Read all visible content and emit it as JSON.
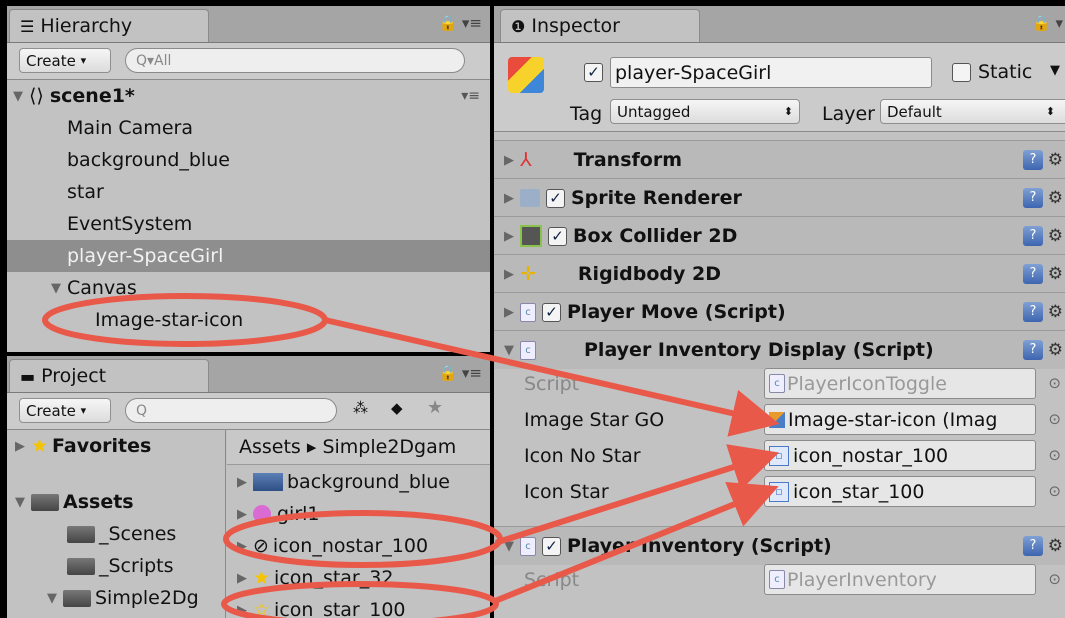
{
  "hierarchy": {
    "tab_label": "Hierarchy",
    "create_label": "Create",
    "search_placeholder": "Q▾All",
    "scene_name": "scene1*",
    "items": [
      {
        "label": "Main Camera"
      },
      {
        "label": "background_blue"
      },
      {
        "label": "star"
      },
      {
        "label": "EventSystem"
      },
      {
        "label": "player-SpaceGirl"
      },
      {
        "label": "Canvas"
      },
      {
        "label": "Image-star-icon"
      }
    ]
  },
  "project": {
    "tab_label": "Project",
    "create_label": "Create",
    "search_placeholder": "Q",
    "favorites_label": "Favorites",
    "assets_label": "Assets",
    "folders": [
      {
        "label": "_Scenes"
      },
      {
        "label": "_Scripts"
      },
      {
        "label": "Simple2Dg"
      }
    ],
    "breadcrumb": "Assets ▸ Simple2Dgam",
    "files": [
      {
        "label": "background_blue"
      },
      {
        "label": "girl1"
      },
      {
        "label": "icon_nostar_100"
      },
      {
        "label": "icon_star_32"
      },
      {
        "label": "icon_star_100"
      }
    ]
  },
  "inspector": {
    "tab_label": "Inspector",
    "object_name": "player-SpaceGirl",
    "static_label": "Static",
    "tag_label": "Tag",
    "tag_value": "Untagged",
    "layer_label": "Layer",
    "layer_value": "Default",
    "components": [
      {
        "label": "Transform"
      },
      {
        "label": "Sprite Renderer"
      },
      {
        "label": "Box Collider 2D"
      },
      {
        "label": "Rigidbody 2D"
      },
      {
        "label": "Player Move (Script)"
      },
      {
        "label": "Player Inventory Display (Script)"
      }
    ],
    "display_props": [
      {
        "label": "Script",
        "value": "PlayerIconToggle"
      },
      {
        "label": "Image Star GO",
        "value": "Image-star-icon (Imag"
      },
      {
        "label": "Icon No Star",
        "value": "icon_nostar_100"
      },
      {
        "label": "Icon Star",
        "value": "icon_star_100"
      }
    ],
    "inventory_component": "Player Inventory (Script)",
    "inventory_script_label": "Script",
    "inventory_script_value": "PlayerInventory"
  },
  "annotation_color": "#e9594a"
}
